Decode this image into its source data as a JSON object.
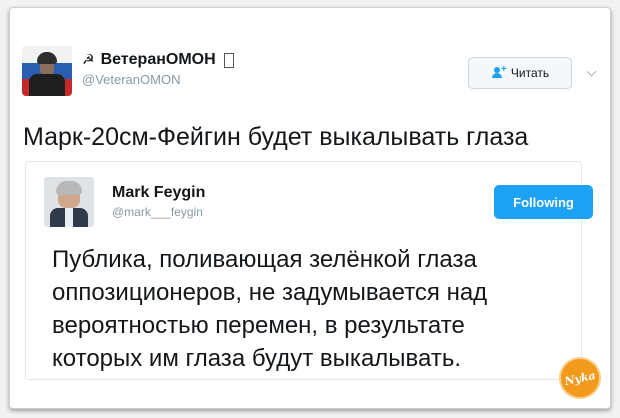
{
  "tweet": {
    "author_name": "ВетеранОМОН",
    "author_handle": "@VeteranOMON",
    "name_prefix_glyph": "☭",
    "follow_label": "Читать",
    "text": "Марк-20см-Фейгин будет выкалывать глаза"
  },
  "quoted_tweet": {
    "author_name": "Mark Feygin",
    "author_handle": "@mark___feygin",
    "following_label": "Following",
    "text_lines": [
      "Публика, поливающая зелёнкой глаза",
      "оппозиционеров, не задумывается над",
      "вероятностью перемен, в результате",
      "которых им глаза будут выкалывать."
    ]
  },
  "watermark": "Nyka",
  "colors": {
    "accent": "#1da1f2",
    "text": "#14171a",
    "muted": "#8899a6",
    "watermark": "#f29a1e"
  },
  "icons": [
    "avatar",
    "follow-person-icon",
    "chevron-down-icon",
    "sickle-icon"
  ]
}
